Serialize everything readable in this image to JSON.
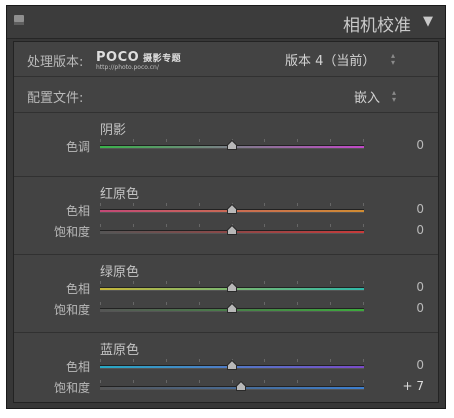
{
  "panel": {
    "title": "相机校准",
    "collapse_icon": "▼"
  },
  "process": {
    "label": "处理版本:",
    "watermark_brand": "POCO",
    "watermark_cn": "摄影专题",
    "watermark_url": "http://photo.poco.cn/",
    "value": "版本 4（当前）"
  },
  "profile": {
    "label": "配置文件:",
    "value": "嵌入"
  },
  "sections": [
    {
      "title": "阴影",
      "sliders": [
        {
          "label": "色调",
          "value": "0",
          "level": 0,
          "min": -100,
          "max": 100,
          "colors": [
            "#39b34a",
            "#c148c8"
          ]
        }
      ]
    },
    {
      "title": "红原色",
      "sliders": [
        {
          "label": "色相",
          "value": "0",
          "level": 0,
          "min": -100,
          "max": 100,
          "colors": [
            "#c24876",
            "#d08c32"
          ]
        },
        {
          "label": "饱和度",
          "value": "0",
          "level": 0,
          "min": -100,
          "max": 100,
          "colors": [
            "#555555",
            "#c83a3a"
          ]
        }
      ]
    },
    {
      "title": "绿原色",
      "sliders": [
        {
          "label": "色相",
          "value": "0",
          "level": 0,
          "min": -100,
          "max": 100,
          "colors": [
            "#c5b63a",
            "#2fb8a8"
          ]
        },
        {
          "label": "饱和度",
          "value": "0",
          "level": 0,
          "min": -100,
          "max": 100,
          "colors": [
            "#555555",
            "#3cab3c"
          ]
        }
      ]
    },
    {
      "title": "蓝原色",
      "sliders": [
        {
          "label": "色相",
          "value": "0",
          "level": 0,
          "min": -100,
          "max": 100,
          "colors": [
            "#27a9c4",
            "#7a4ac8"
          ]
        },
        {
          "label": "饱和度",
          "value": "+ 7",
          "level": 7,
          "min": -100,
          "max": 100,
          "colors": [
            "#555555",
            "#3d7fcf"
          ]
        }
      ]
    }
  ]
}
